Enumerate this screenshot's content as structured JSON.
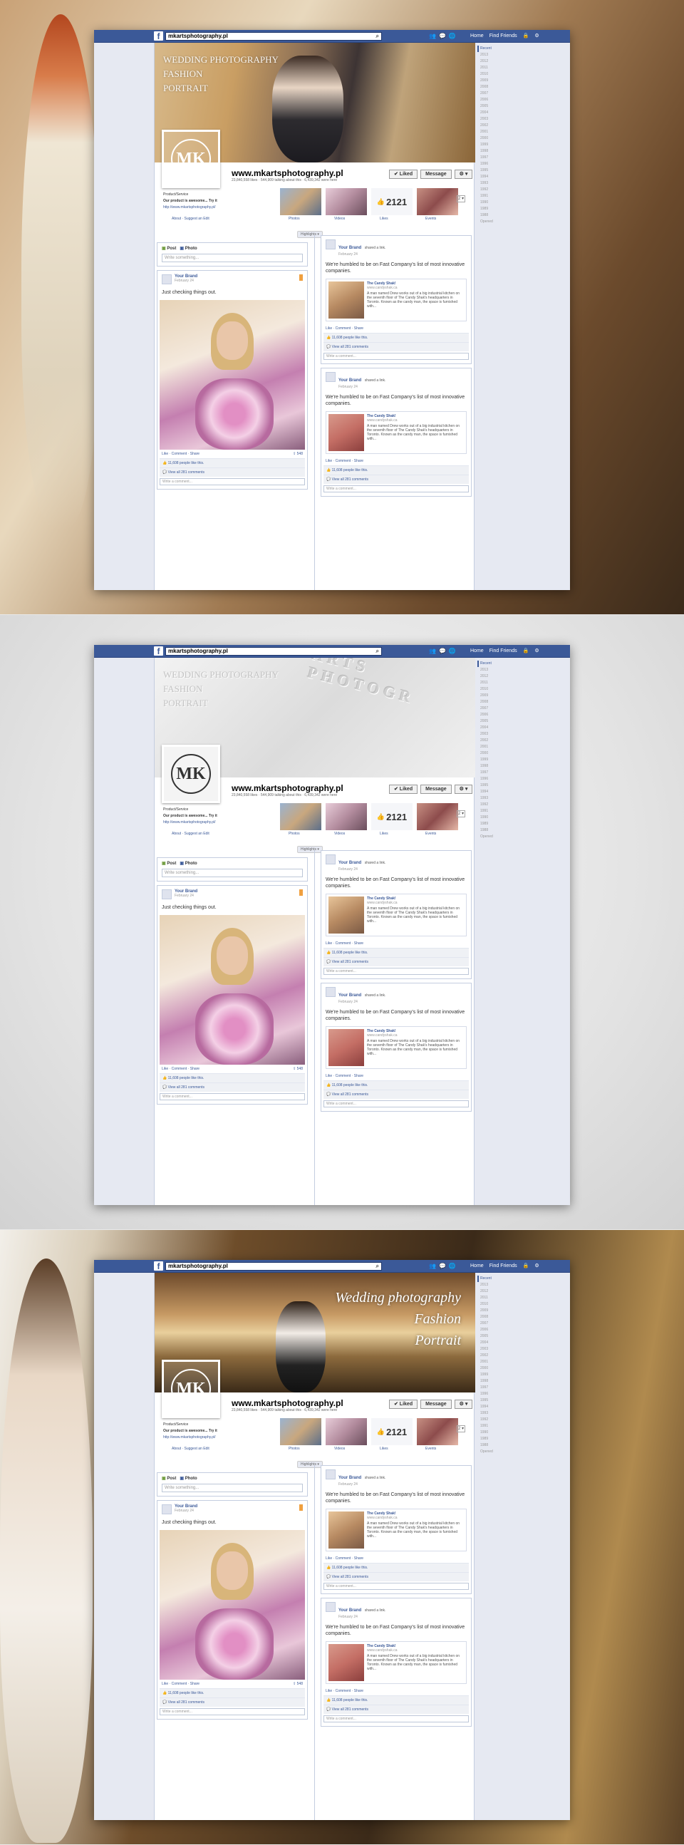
{
  "header": {
    "search_value": "mkartsphotography.pl",
    "nav": [
      "Home",
      "Find Friends"
    ]
  },
  "page": {
    "name": "www.mkartsphotography.pl",
    "stats": "23,840,558 likes · 544,909 talking about this · 6,439,342 were here",
    "liked_label": "✔ Liked",
    "message_label": "Message",
    "category": "Product/Service",
    "about": "Our product is awesome... Try it",
    "about_link": "http://www.mkartsphotography.pl/",
    "about_links": "About · Suggest an Edit",
    "monogram": "MK"
  },
  "covers": [
    {
      "text_lines": [
        "WEDDING PHOTOGRAPHY",
        "FASHION",
        "PORTRAIT"
      ]
    },
    {
      "text_lines": [
        "WEDDING PHOTOGRAPHY",
        "FASHION",
        "PORTRAIT"
      ],
      "emboss": "ARTS PHOTOGR"
    },
    {
      "script_lines": [
        "Wedding photography",
        "Fashion",
        "Portrait"
      ]
    }
  ],
  "apps": {
    "labels": [
      "Photos",
      "Videos",
      "Likes",
      "Events"
    ],
    "likes_count": "2121"
  },
  "highlights_label": "Highlights ▾",
  "composer": {
    "post": "Post",
    "photo": "Photo",
    "placeholder": "Write something..."
  },
  "left_post": {
    "author": "Your Brand",
    "date": "February 24",
    "text": "Just checking things out.",
    "actions": "Like · Comment · Share",
    "shares": "548",
    "likes": "11,608 people like this.",
    "comments": "View all 281 comments",
    "comment_placeholder": "Write a comment..."
  },
  "right_posts": [
    {
      "author": "Your Brand",
      "shared": "shared a link.",
      "date": "February 24",
      "text": "We're humbled to be on Fast Company's list of most innovative companies.",
      "link_title": "The Candy Shak!",
      "link_url": "www.candyshak.ca",
      "link_desc": "A man named Drew works out of a big industrial kitchen on the seventh floor of The Candy Shak's headquarters in Toronto. Known as the candy man, the space is furnished with...",
      "actions": "Like · Comment · Share",
      "likes": "11,608 people like this.",
      "comments": "View all 281 comments",
      "comment_placeholder": "Write a comment..."
    },
    {
      "author": "Your Brand",
      "shared": "shared a link.",
      "date": "February 24",
      "text": "We're humbled to be on Fast Company's list of most innovative companies.",
      "link_title": "The Candy Shak!",
      "link_url": "www.candyshak.ca",
      "link_desc": "A man named Drew works out of a big industrial kitchen on the seventh floor of The Candy Shak's headquarters in Toronto. Known as the candy man, the space is furnished with...",
      "actions": "Like · Comment · Share",
      "likes": "11,608 people like this.",
      "comments": "View all 281 comments",
      "comment_placeholder": "Write a comment..."
    }
  ],
  "timeline_years": [
    "Recent",
    "2013",
    "2012",
    "2011",
    "2010",
    "2009",
    "2008",
    "2007",
    "2006",
    "2005",
    "2004",
    "2003",
    "2002",
    "2001",
    "2000",
    "1999",
    "1998",
    "1997",
    "1996",
    "1995",
    "1994",
    "1993",
    "1992",
    "1991",
    "1990",
    "1989",
    "1988",
    "Opened"
  ]
}
